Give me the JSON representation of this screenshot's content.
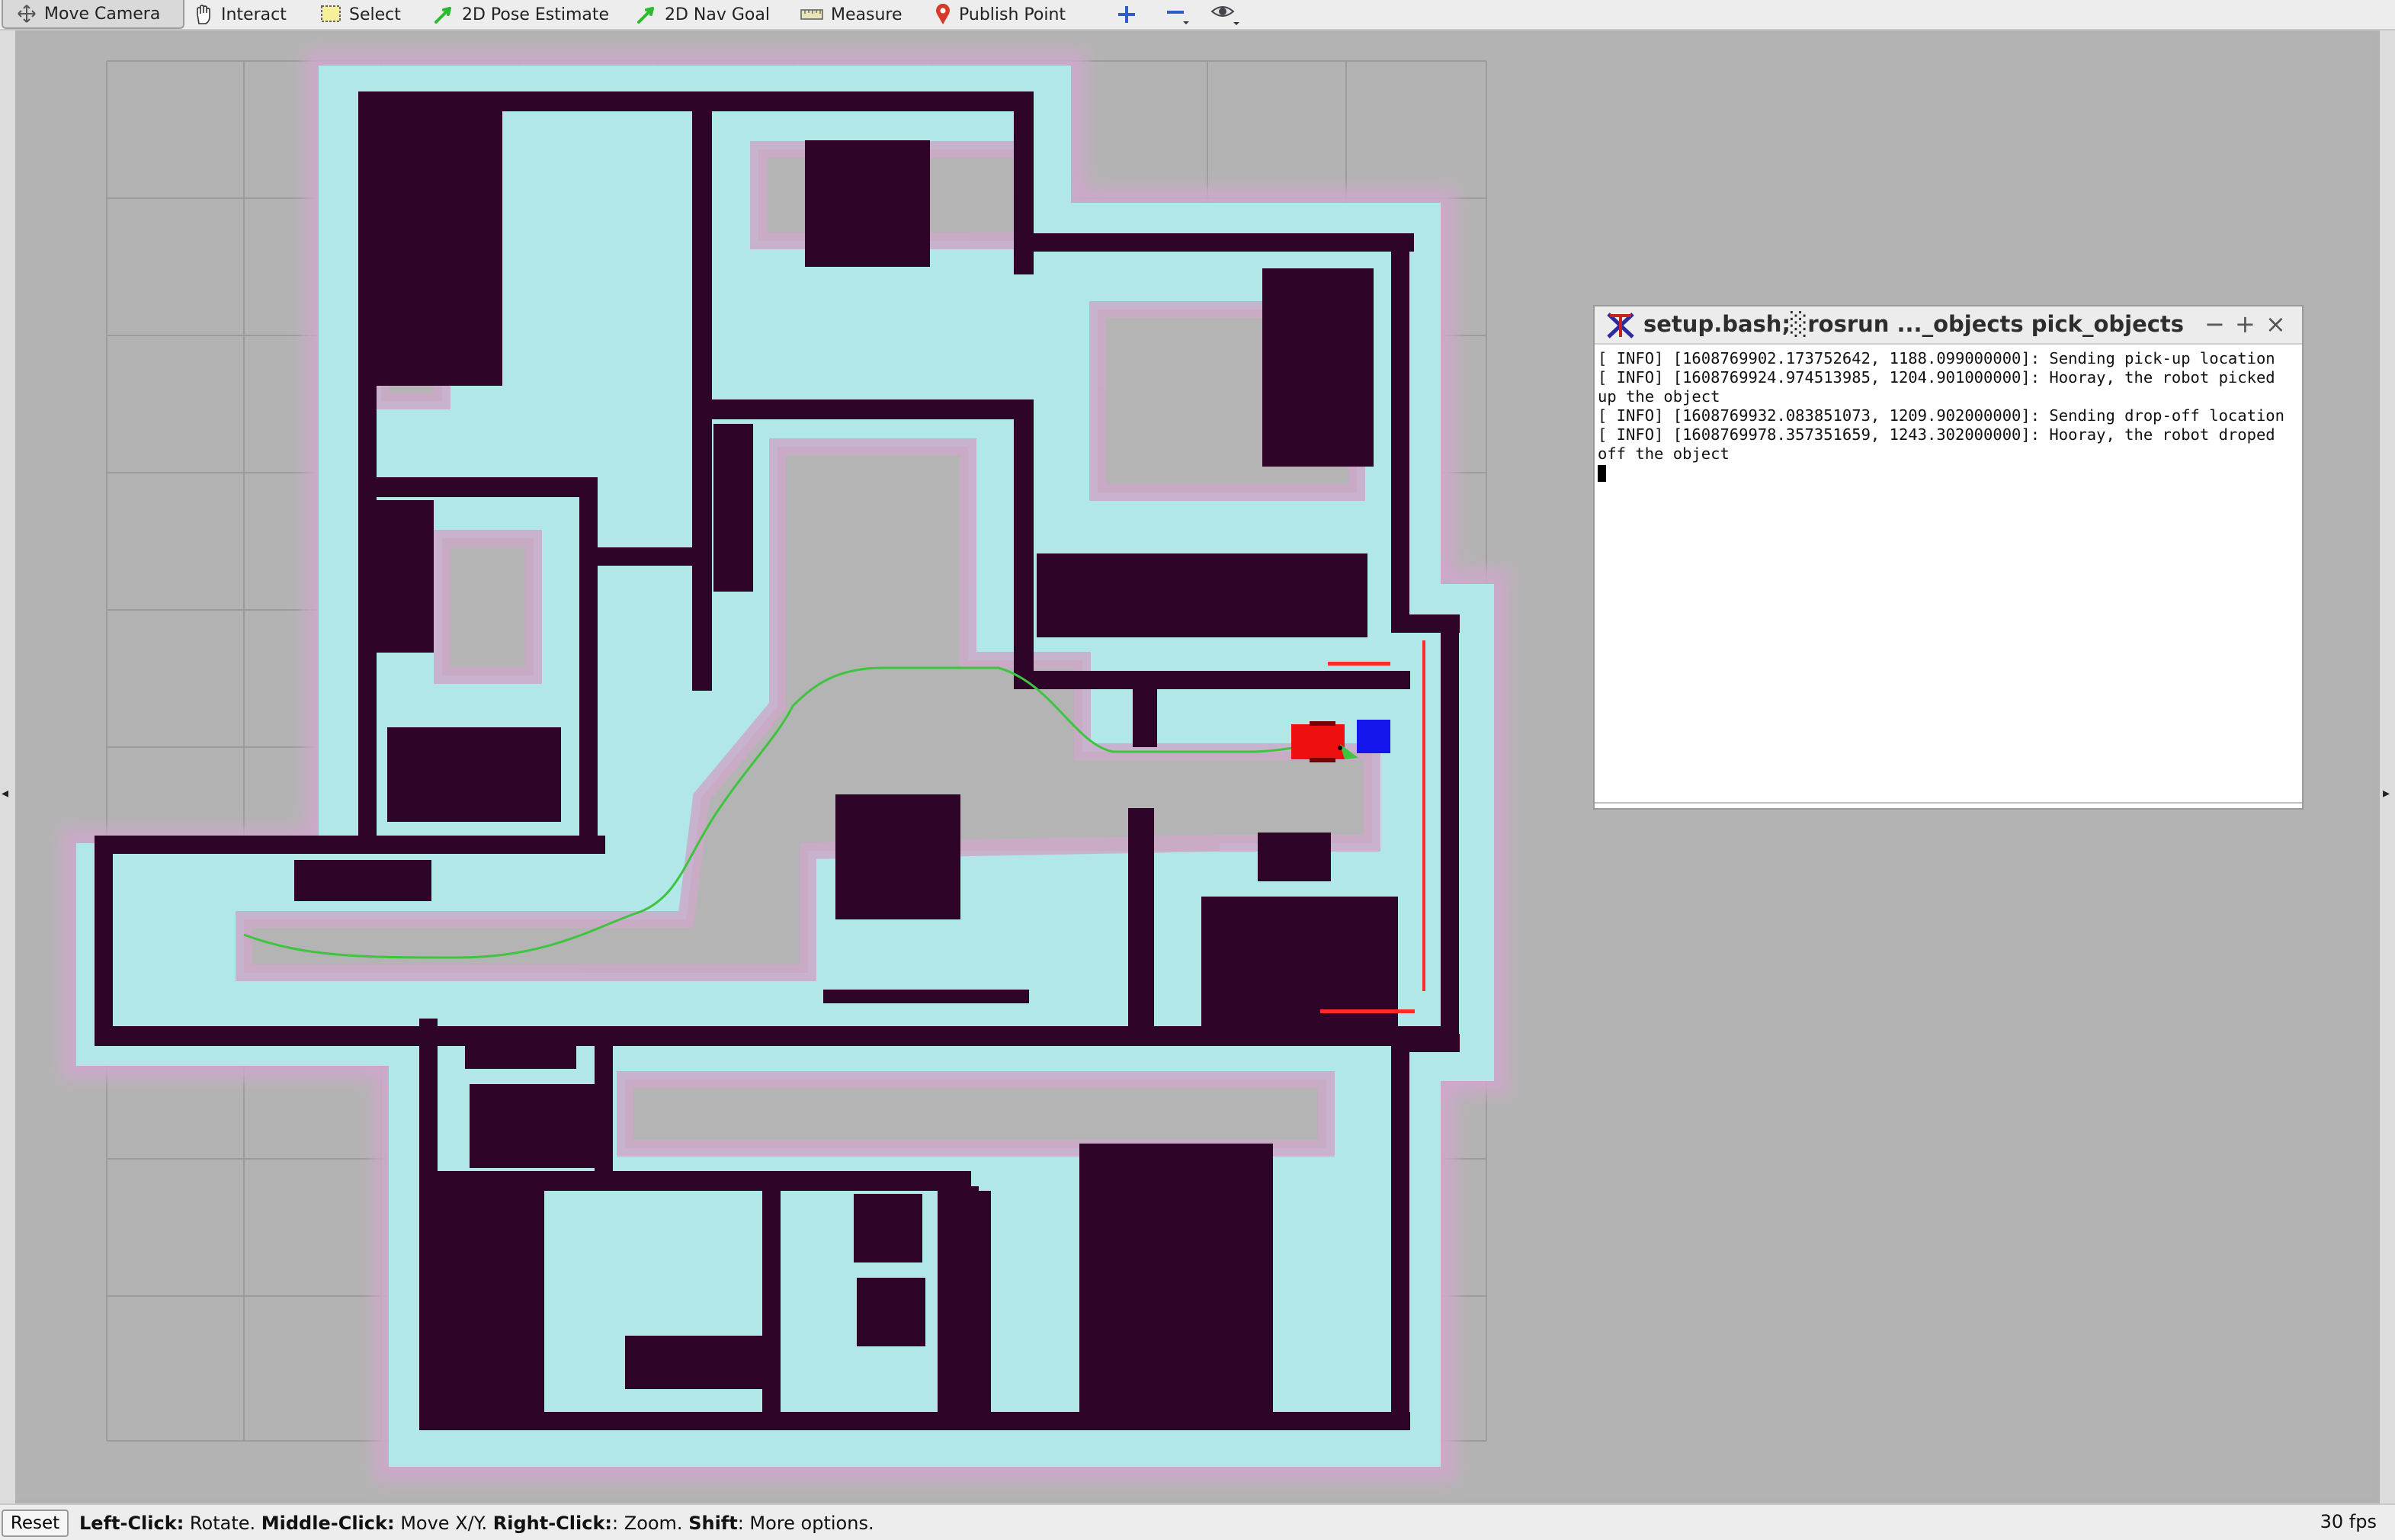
{
  "toolbar": {
    "tools": [
      "Move Camera",
      "Interact",
      "Select",
      "2D Pose Estimate",
      "2D Nav Goal",
      "Measure",
      "Publish Point"
    ],
    "active_tool": "Move Camera",
    "icons": [
      "move-camera-icon",
      "hand-icon",
      "select-icon",
      "pose-arrow-icon",
      "nav-goal-arrow-icon",
      "ruler-icon",
      "map-pin-icon",
      "add-tool-icon",
      "remove-tool-icon",
      "view-eye-icon"
    ]
  },
  "terminal": {
    "title": "setup.bash;░rosrun ..._objects pick_objects",
    "lines": [
      "[ INFO] [1608769902.173752642, 1188.099000000]: Sending pick-up location",
      "[ INFO] [1608769924.974513985, 1204.901000000]: Hooray, the robot picked up the object",
      "[ INFO] [1608769932.083851073, 1209.902000000]: Sending drop-off location",
      "[ INFO] [1608769978.357351659, 1243.302000000]: Hooray, the robot droped off the object"
    ],
    "buttons": [
      "−",
      "+",
      "×"
    ]
  },
  "statusbar": {
    "reset_label": "Reset",
    "hints": [
      {
        "key": "Left-Click:",
        "text": " Rotate. "
      },
      {
        "key": "Middle-Click:",
        "text": " Move X/Y. "
      },
      {
        "key": "Right-Click:",
        "text": ": Zoom. "
      },
      {
        "key": "Shift",
        "text": ": More options."
      }
    ],
    "fps": "30 fps"
  },
  "colors": {
    "map_background": "#b3b3b3",
    "inflation": "#b1e7e7",
    "inflation_halo": "#cda9c9",
    "obstacle": "#2f0429",
    "path": "#3fc43f",
    "robot": "#ee1010",
    "marker": "#1515ee"
  }
}
